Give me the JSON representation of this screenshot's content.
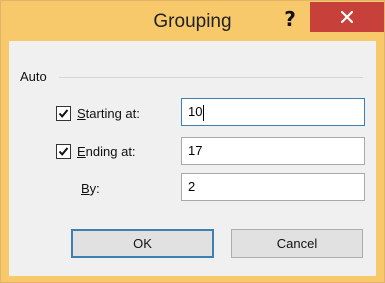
{
  "window": {
    "title": "Grouping",
    "help_label": "?",
    "close_icon": "close-icon"
  },
  "group": {
    "label": "Auto"
  },
  "fields": {
    "starting": {
      "checked": true,
      "label_accel": "S",
      "label_rest": "tarting at:",
      "value": "10"
    },
    "ending": {
      "checked": true,
      "label_accel": "E",
      "label_rest": "nding at:",
      "value": "17"
    },
    "by": {
      "label_accel": "B",
      "label_rest": "y:",
      "value": "2"
    }
  },
  "buttons": {
    "ok_label": "OK",
    "cancel_label": "Cancel"
  },
  "colors": {
    "titlebar": "#f7c96b",
    "close_button": "#c7403a",
    "focus_border": "#3c7fb1"
  }
}
